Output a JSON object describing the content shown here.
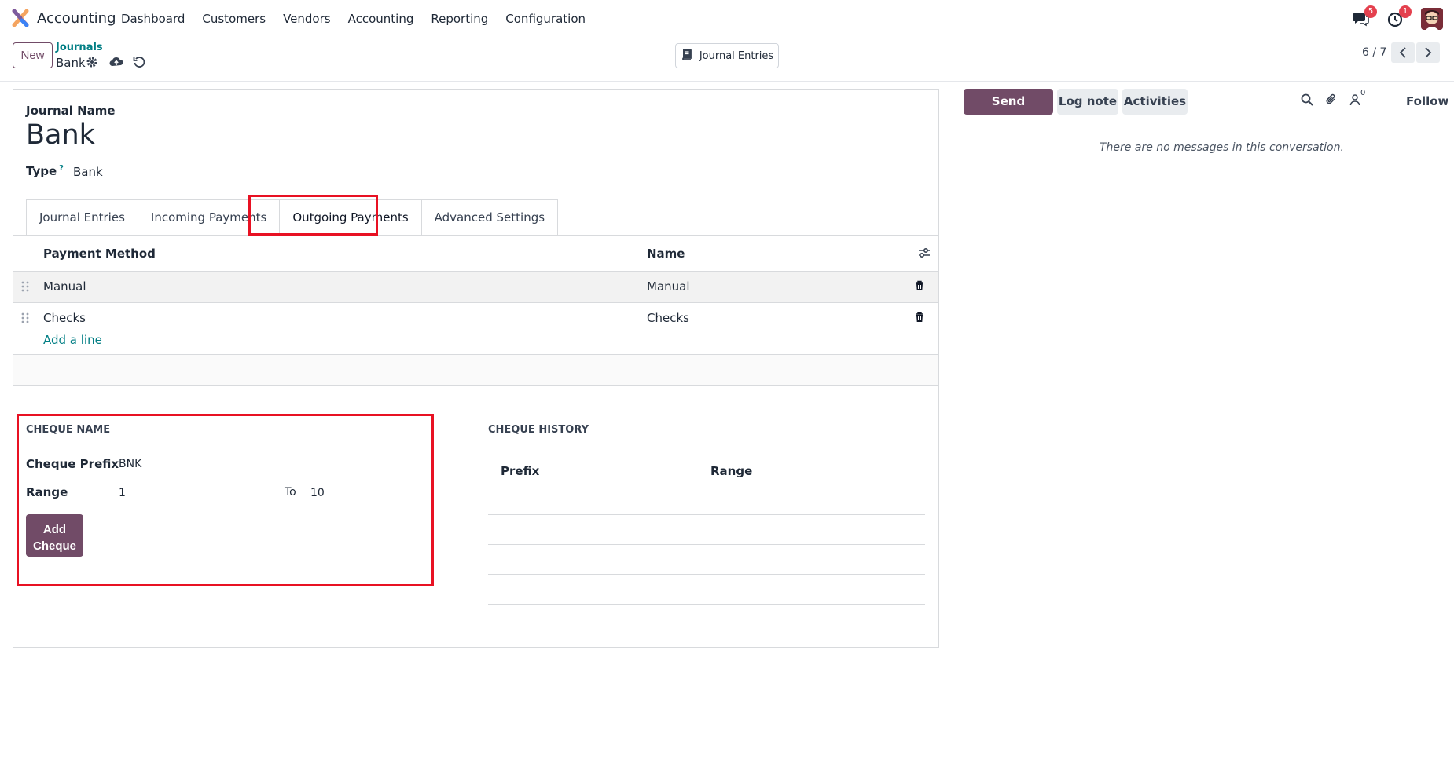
{
  "navbar": {
    "app_name": "Accounting",
    "menu": [
      "Dashboard",
      "Customers",
      "Vendors",
      "Accounting",
      "Reporting",
      "Configuration"
    ],
    "messages_badge": "5",
    "activities_badge": "1"
  },
  "control_panel": {
    "new_label": "New",
    "breadcrumb_parent": "Journals",
    "breadcrumb_current": "Bank",
    "smart_button_label": "Journal Entries",
    "pager": "6 / 7"
  },
  "form": {
    "journal_name_label": "Journal Name",
    "journal_name_value": "Bank",
    "type_label": "Type",
    "type_help": "?",
    "type_value": "Bank",
    "tabs": [
      "Journal Entries",
      "Incoming Payments",
      "Outgoing Payments",
      "Advanced Settings"
    ],
    "active_tab": "Outgoing Payments",
    "table": {
      "columns": [
        "Payment Method",
        "Name"
      ],
      "rows": [
        {
          "payment_method": "Manual",
          "name": "Manual"
        },
        {
          "payment_method": "Checks",
          "name": "Checks"
        }
      ],
      "add_line": "Add a line"
    },
    "cheque_name": {
      "title": "CHEQUE NAME",
      "prefix_label": "Cheque Prefix",
      "prefix_value": "BNK",
      "range_label": "Range",
      "range_from": "1",
      "to_label": "To",
      "range_to": "10",
      "add_button": "Add Cheque"
    },
    "cheque_history": {
      "title": "CHEQUE HISTORY",
      "columns": [
        "Prefix",
        "Range"
      ]
    }
  },
  "chatter": {
    "send_message": "Send message",
    "log_note": "Log note",
    "activities": "Activities",
    "followers_count": "0",
    "follow": "Follow",
    "empty_text": "There are no messages in this conversation."
  },
  "colors": {
    "brand": "#714b67",
    "link": "#017e84",
    "highlight": "#e81123"
  }
}
